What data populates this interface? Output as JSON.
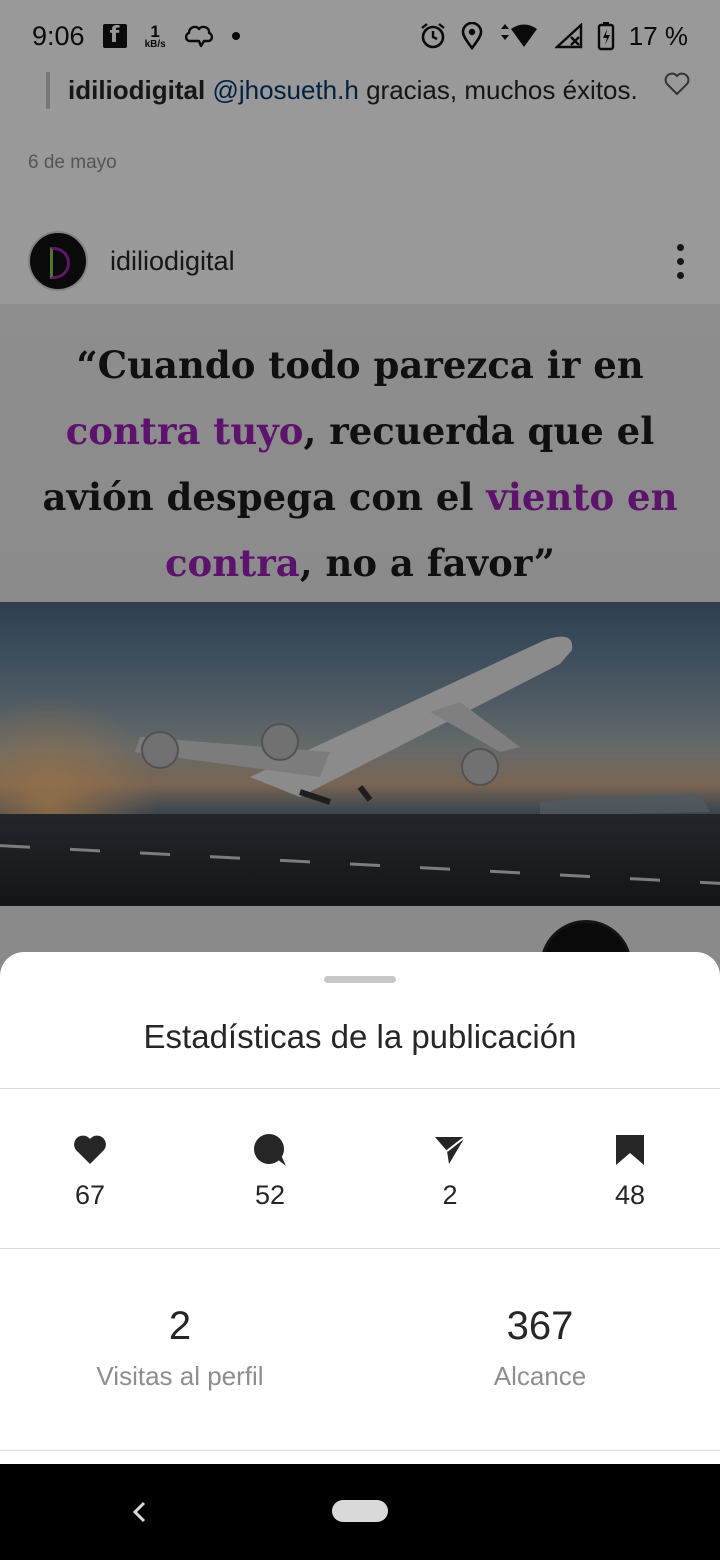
{
  "status_bar": {
    "time": "9:06",
    "speed_value": "1",
    "speed_unit": "kB/s",
    "battery": "17 %",
    "icons": [
      "facebook-icon",
      "messenger-icon",
      "alarm-icon",
      "location-icon",
      "wifi-icon",
      "signal-icon",
      "battery-icon"
    ]
  },
  "feed": {
    "comment": {
      "user": "idiliodigital",
      "mention": "@jhosueth.h",
      "text": "gracias, muchos éxitos."
    },
    "date": "6 de mayo",
    "post": {
      "username": "idiliodigital",
      "quote": {
        "part1": "“Cuando todo parezca ir en ",
        "hl1": "contra tuyo",
        "part2": ", recuerda que el avión despega con el ",
        "hl2": "viento en contra",
        "part3": ", no a favor”"
      }
    }
  },
  "sheet": {
    "title": "Estadísticas de la publicación",
    "stats": [
      {
        "icon": "heart-icon",
        "value": "67"
      },
      {
        "icon": "comment-icon",
        "value": "52"
      },
      {
        "icon": "send-icon",
        "value": "2"
      },
      {
        "icon": "bookmark-icon",
        "value": "48"
      }
    ],
    "metrics": [
      {
        "value": "2",
        "label": "Visitas al perfil"
      },
      {
        "value": "367",
        "label": "Alcance"
      }
    ]
  },
  "colors": {
    "highlight": "#9c1fb3",
    "text": "#262626",
    "secondary": "#8e8e8e"
  }
}
